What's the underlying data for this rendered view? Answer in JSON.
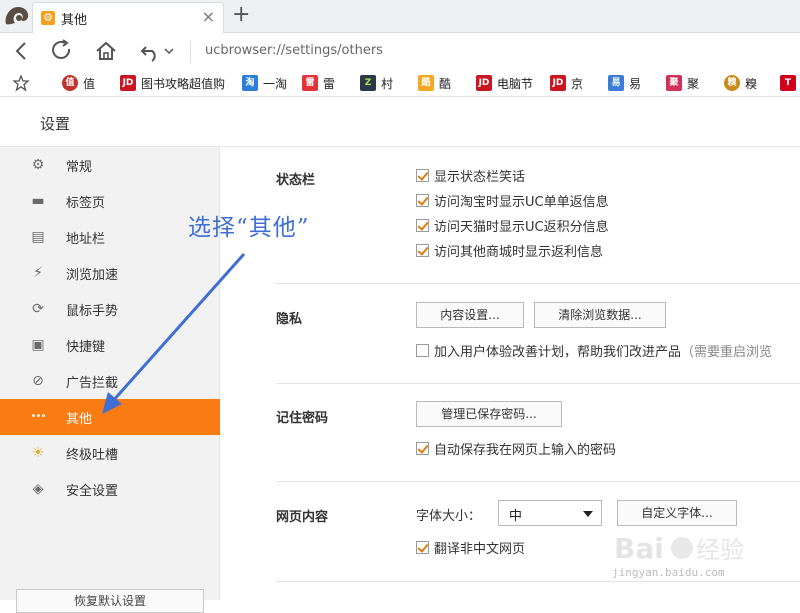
{
  "tab": {
    "title": "其他",
    "close_glyph": "×",
    "new_tab_glyph": "+"
  },
  "toolbar": {
    "url": "ucbrowser://settings/others"
  },
  "bookmarks": [
    {
      "label": "值",
      "icon_text": "值",
      "color": "#c0342c"
    },
    {
      "label": "图书攻略超值购",
      "icon_text": "JD",
      "color": "#c81623"
    },
    {
      "label": "一淘",
      "icon_text": "淘",
      "color": "#2a7fd6"
    },
    {
      "label": "雷",
      "icon_text": "雷",
      "color": "#e5323a"
    },
    {
      "label": "村",
      "icon_text": "Z",
      "color": "#2b3a4a"
    },
    {
      "label": "酷",
      "icon_text": "酷",
      "color": "#f5a623"
    },
    {
      "label": "电脑节",
      "icon_text": "JD",
      "color": "#c81623"
    },
    {
      "label": "京",
      "icon_text": "JD",
      "color": "#c81623"
    },
    {
      "label": "易",
      "icon_text": "易",
      "color": "#3b7cd8"
    },
    {
      "label": "聚",
      "icon_text": "聚",
      "color": "#d32f5c"
    },
    {
      "label": "糗",
      "icon_text": "糗",
      "color": "#c98b1a"
    },
    {
      "label": "",
      "icon_text": "T",
      "color": "#d0021b"
    }
  ],
  "settings": {
    "title": "设置"
  },
  "sidebar": {
    "items": [
      {
        "label": "常规",
        "icon": "gear-icon",
        "glyph": "⚙"
      },
      {
        "label": "标签页",
        "icon": "tab-icon",
        "glyph": "▬"
      },
      {
        "label": "地址栏",
        "icon": "address-bar-icon",
        "glyph": "▤"
      },
      {
        "label": "浏览加速",
        "icon": "lightning-icon",
        "glyph": "⚡"
      },
      {
        "label": "鼠标手势",
        "icon": "mouse-gesture-icon",
        "glyph": "⟳"
      },
      {
        "label": "快捷键",
        "icon": "keyboard-icon",
        "glyph": "▣"
      },
      {
        "label": "广告拦截",
        "icon": "block-icon",
        "glyph": "⊘"
      },
      {
        "label": "其他",
        "icon": "more-icon",
        "glyph": "•••"
      },
      {
        "label": "终极吐槽",
        "icon": "bulb-icon",
        "glyph": "☀"
      },
      {
        "label": "安全设置",
        "icon": "shield-icon",
        "glyph": "◈"
      }
    ],
    "active_index": 7,
    "bottom_button": "恢复默认设置"
  },
  "main": {
    "status_bar": {
      "label": "状态栏",
      "options": [
        {
          "text": "显示状态栏笑话",
          "checked": true
        },
        {
          "text": "访问淘宝时显示UC单单返信息",
          "checked": true
        },
        {
          "text": "访问天猫时显示UC返积分信息",
          "checked": true
        },
        {
          "text": "访问其他商城时显示返利信息",
          "checked": true
        }
      ]
    },
    "privacy": {
      "label": "隐私",
      "content_settings": "内容设置...",
      "clear_data": "清除浏览数据...",
      "ux_plan": "加入用户体验改善计划，帮助我们改进产品",
      "ux_hint": "（需要重启浏览",
      "ux_checked": false
    },
    "passwords": {
      "label": "记住密码",
      "manage": "管理已保存密码...",
      "autosave": "自动保存我在网页上输入的密码",
      "autosave_checked": true
    },
    "web_content": {
      "label": "网页内容",
      "font_size_label": "字体大小：",
      "font_size_value": "中",
      "custom_fonts": "自定义字体...",
      "translate": "翻译非中文网页",
      "translate_checked": true
    }
  },
  "annotation": {
    "text": "选择“其他”",
    "color": "#3f6fd4"
  },
  "watermark": {
    "text": "Baidu经验",
    "sub": "jingyan.baidu.com"
  },
  "colors": {
    "accent": "#f97c12",
    "checkmark": "#e07a10"
  }
}
